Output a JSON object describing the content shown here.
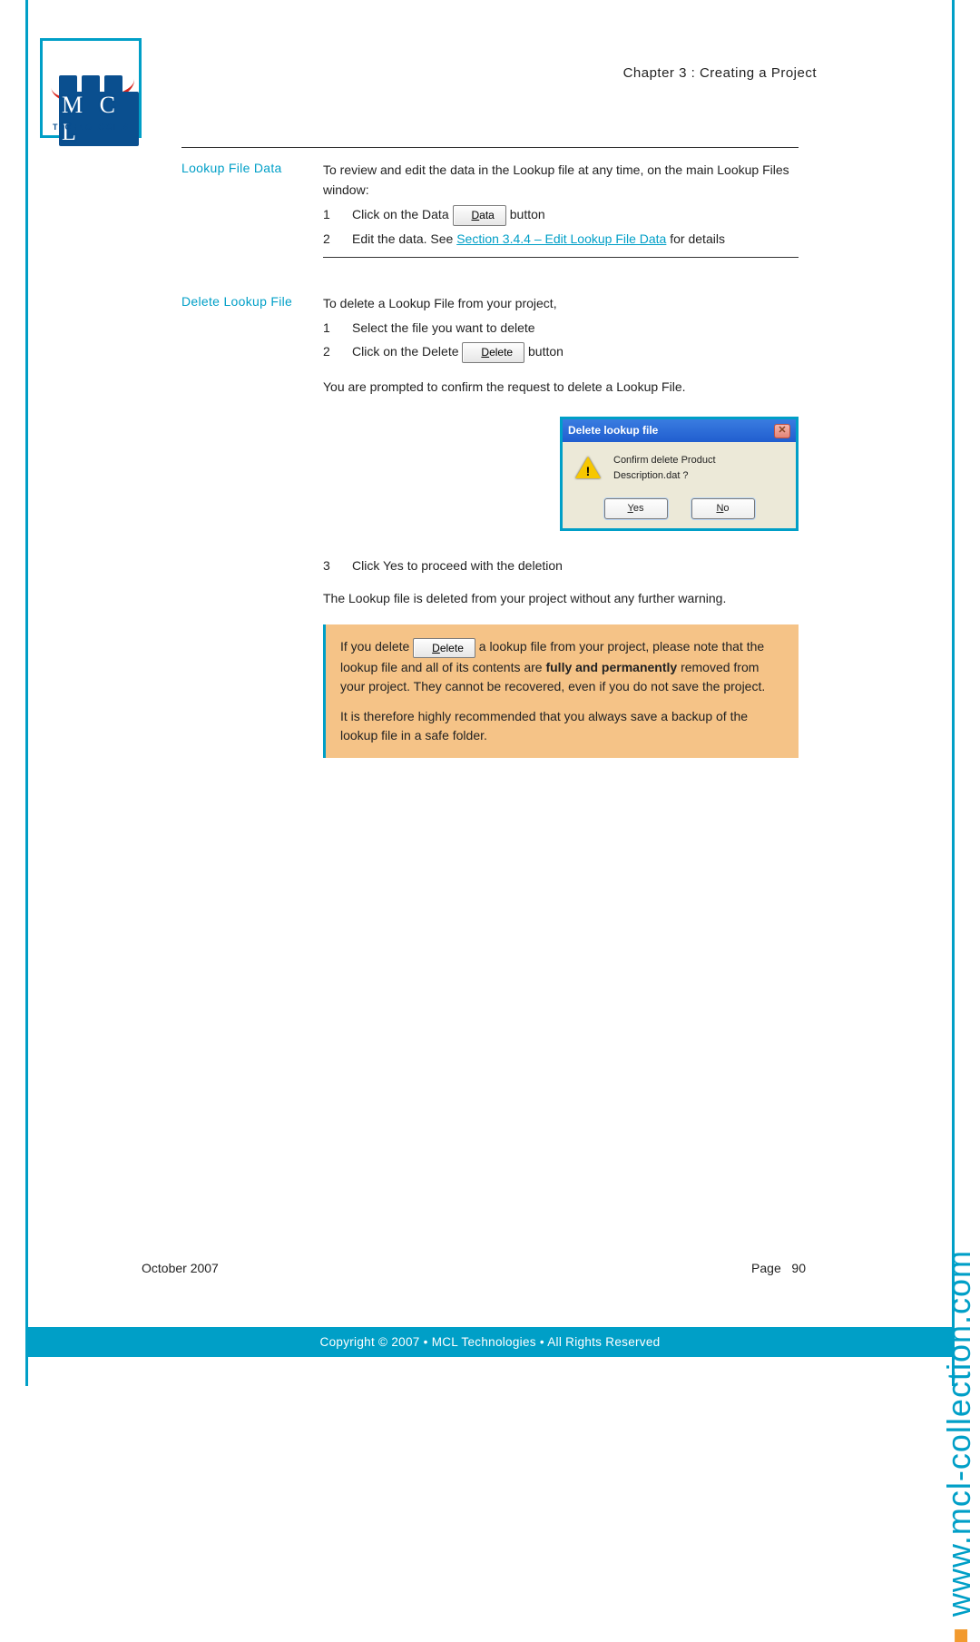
{
  "header": {
    "chapter": "Chapter 3 : Creating a Project"
  },
  "logo": {
    "letters": "M C L",
    "sub": "TECHNOLOGIES"
  },
  "section1": {
    "label": "Lookup File Data",
    "intro": "To review and edit the data in the Lookup file at any time, on the main Lookup Files window:",
    "step1_num": "1",
    "step1_pre": "Click on the Data ",
    "step1_btn": "ata",
    "step1_btn_u": "D",
    "step1_post": " button",
    "step2_num": "2",
    "step2_pre": "Edit the data. See ",
    "step2_link": "Section 3.4.4 – Edit Lookup File Data",
    "step2_post": " for details"
  },
  "section2": {
    "label": "Delete Lookup File",
    "intro": "To delete a Lookup File from your project,",
    "step1_num": "1",
    "step1_txt": "Select the file you want to delete",
    "step2_num": "2",
    "step2_pre": "Click on the Delete ",
    "step2_btn": "elete",
    "step2_btn_u": "D",
    "step2_post": " button",
    "confirm_para": "You are prompted to confirm the request to delete a Lookup File.",
    "step3_num": "3",
    "step3_txt": "Click Yes to proceed with the deletion",
    "deleted_para": "The Lookup file is deleted from your project without any further warning."
  },
  "dialog": {
    "title": "Delete lookup file",
    "message": "Confirm delete Product Description.dat ?",
    "yes_u": "Y",
    "yes_rest": "es",
    "no_u": "N",
    "no_rest": "o"
  },
  "note": {
    "p1_pre": "If you delete ",
    "p1_btn_u": "D",
    "p1_btn": "elete",
    "p1_mid": "a lookup file from your project, please note that the lookup file and all of its contents are ",
    "p1_bold": "fully and permanently",
    "p1_post": " removed from your project. They cannot be recovered, even if you do not save the project.",
    "p2": "It is therefore highly recommended that you always save a backup of the lookup file in a safe folder."
  },
  "footer": {
    "date": "October 2007",
    "page_label": "Page",
    "page_num": "90",
    "copyright": "Copyright © 2007 • MCL Technologies • All Rights Reserved"
  },
  "side_url": "www.mcl-collection.com"
}
